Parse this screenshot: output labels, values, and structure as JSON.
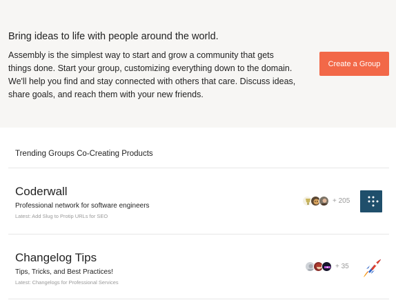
{
  "hero": {
    "headline": "Bring ideas to life with people around the world.",
    "body": "Assembly is the simplest way to start and grow a community that gets things done. Start your group, customizing everything down to the domain. We'll help you find and stay connected with others that care. Discuss ideas, share goals, and reach them with your new friends.",
    "cta_label": "Create a Group",
    "cta_color": "#f26848"
  },
  "trending": {
    "title": "Trending Groups Co-Creating Products",
    "groups": [
      {
        "name": "Coderwall",
        "description": "Professional network for software engineers",
        "latest": "Latest: Add Slug to Protip URLs for SEO",
        "member_count": "+ 205",
        "logo_icon": "coderwall-grid-logo-icon",
        "logo_color": "#1f4f6b"
      },
      {
        "name": "Changelog Tips",
        "description": "Tips, Tricks, and Best Practices!",
        "latest": "Latest: Changelogs for Professional Services",
        "member_count": "+ 35",
        "logo_icon": "rocket-logo-icon",
        "logo_color": "#2f66c9"
      }
    ]
  }
}
